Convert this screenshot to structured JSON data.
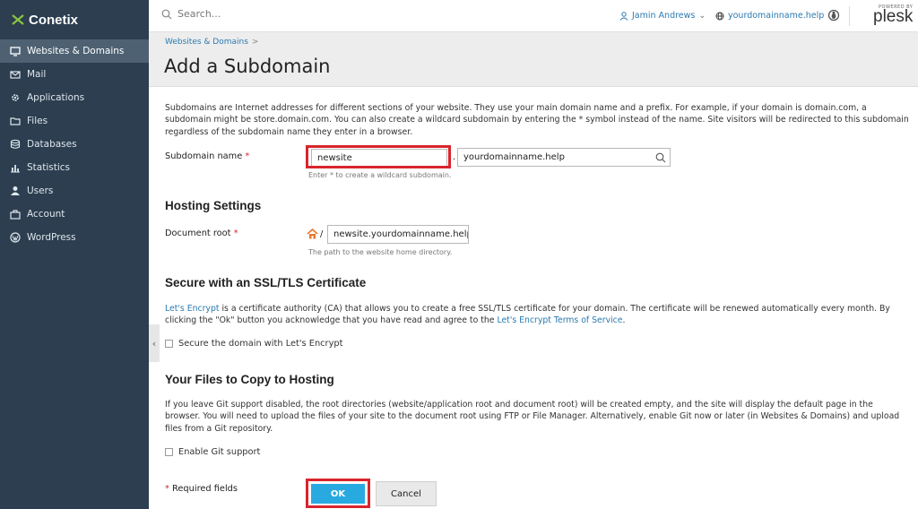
{
  "brand": {
    "name": "Conetix"
  },
  "sidebar": {
    "items": [
      {
        "label": "Websites & Domains",
        "icon": "monitor-icon",
        "active": true
      },
      {
        "label": "Mail",
        "icon": "mail-icon"
      },
      {
        "label": "Applications",
        "icon": "gear-icon"
      },
      {
        "label": "Files",
        "icon": "folder-icon"
      },
      {
        "label": "Databases",
        "icon": "database-icon"
      },
      {
        "label": "Statistics",
        "icon": "bar-chart-icon"
      },
      {
        "label": "Users",
        "icon": "user-icon"
      },
      {
        "label": "Account",
        "icon": "briefcase-icon"
      },
      {
        "label": "WordPress",
        "icon": "wordpress-icon"
      }
    ]
  },
  "header": {
    "search_placeholder": "Search...",
    "user": "Jamin Andrews",
    "domain": "yourdomainname.help",
    "powered_by": "POWERED BY",
    "plesk": "plesk"
  },
  "page": {
    "breadcrumb": "Websites & Domains",
    "breadcrumb_sep": ">",
    "title": "Add a Subdomain",
    "description": "Subdomains are Internet addresses for different sections of your website. They use your main domain name and a prefix. For example, if your domain is domain.com, a subdomain might be store.domain.com. You can also create a wildcard subdomain by entering the * symbol instead of the name. Site visitors will be redirected to this subdomain regardless of the subdomain name they enter in a browser."
  },
  "form": {
    "subdomain_label": "Subdomain name",
    "required_mark": "*",
    "subdomain_value": "newsite",
    "dot": ".",
    "parent_domain": "yourdomainname.help",
    "subdomain_hint": "Enter * to create a wildcard subdomain.",
    "hosting_title": "Hosting Settings",
    "docroot_label": "Document root",
    "docroot_slash": "/",
    "docroot_value": "newsite.yourdomainname.help",
    "docroot_hint": "The path to the website home directory.",
    "ssl_title": "Secure with an SSL/TLS Certificate",
    "ssl_link1": "Let's Encrypt",
    "ssl_text": " is a certificate authority (CA) that allows you to create a free SSL/TLS certificate for your domain. The certificate will be renewed automatically every month. By clicking the \"Ok\" button you acknowledge that you have read and agree to the ",
    "ssl_link2": "Let's Encrypt Terms of Service",
    "ssl_end": ".",
    "ssl_checkbox": "Secure the domain with Let's Encrypt",
    "files_title": "Your Files to Copy to Hosting",
    "files_text": "If you leave Git support disabled, the root directories (website/application root and document root) will be created empty, and the site will display the default page in the browser. You will need to upload the files of your site to the document root using FTP or File Manager. Alternatively, enable Git now or later (in Websites & Domains) and upload files from a Git repository.",
    "git_checkbox": "Enable Git support",
    "required_note": "Required fields",
    "ok": "OK",
    "cancel": "Cancel"
  },
  "colors": {
    "sidebar": "#2c3e50",
    "link": "#2a7ab0",
    "highlight": "#d9252c",
    "ok_button": "#28aae1"
  }
}
